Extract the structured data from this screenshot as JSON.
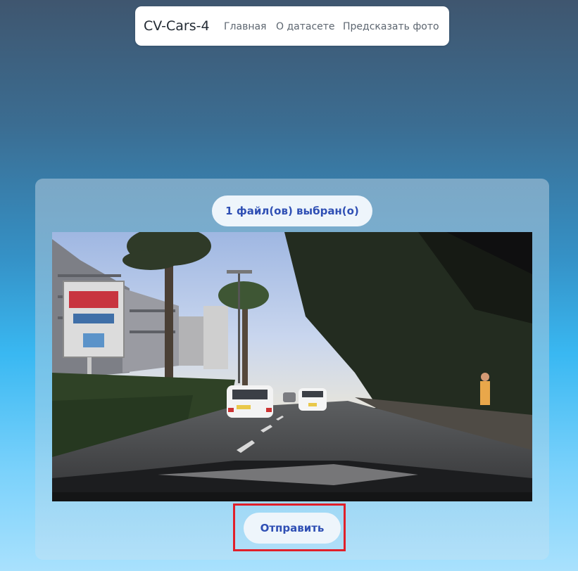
{
  "navbar": {
    "brand": "CV-Cars-4",
    "links": [
      {
        "label": "Главная"
      },
      {
        "label": "О датасете"
      },
      {
        "label": "Предсказать фото"
      }
    ]
  },
  "upload": {
    "file_status": "1 файл(ов) выбран(о)",
    "submit_label": "Отправить"
  },
  "colors": {
    "accent_text": "#2f4fb4",
    "highlight_border": "#e0202a",
    "pill_background": "#eef5fb"
  }
}
